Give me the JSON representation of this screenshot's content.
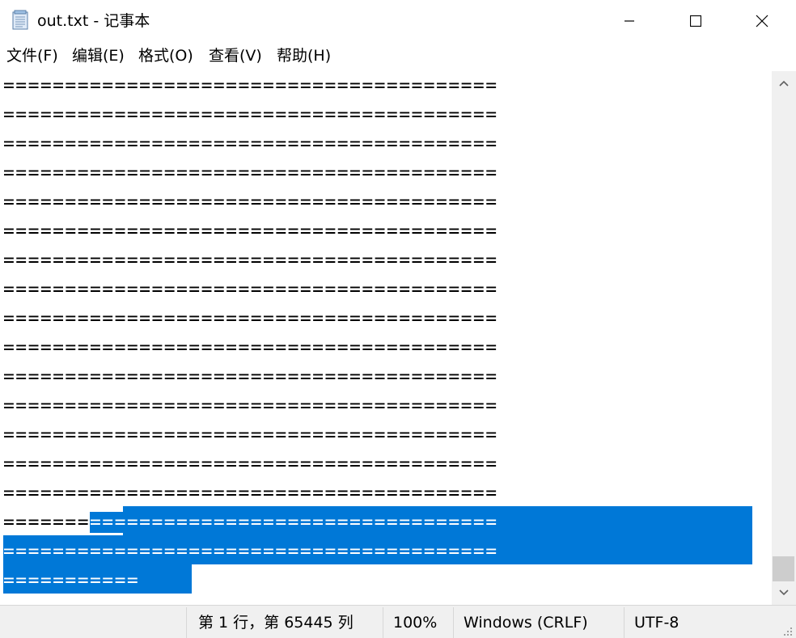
{
  "window": {
    "title": "out.txt - 记事本",
    "buttons": {
      "minimize": "minimize-icon",
      "maximize": "maximize-icon",
      "close": "close-icon"
    }
  },
  "menu": {
    "items": [
      {
        "label": "文件(F)"
      },
      {
        "label": "编辑(E)"
      },
      {
        "label": "格式(O)"
      },
      {
        "label": "查看(V)"
      },
      {
        "label": "帮助(H)"
      }
    ]
  },
  "editor": {
    "lines": [
      "========================================",
      "========================================",
      "========================================",
      "========================================",
      "========================================",
      "========================================",
      "========================================",
      "========================================",
      "========================================",
      "========================================",
      "========================================",
      "========================================",
      "========================================",
      "========================================",
      "========================================"
    ],
    "line16_plain": "=======",
    "line16_selected": "=================================",
    "line17_selected": "========================================",
    "line18_selected": "===========",
    "selection_color": "#0078d7"
  },
  "statusbar": {
    "position": "第 1 行，第 65445 列",
    "zoom": "100%",
    "line_ending": "Windows (CRLF)",
    "encoding": "UTF-8"
  }
}
